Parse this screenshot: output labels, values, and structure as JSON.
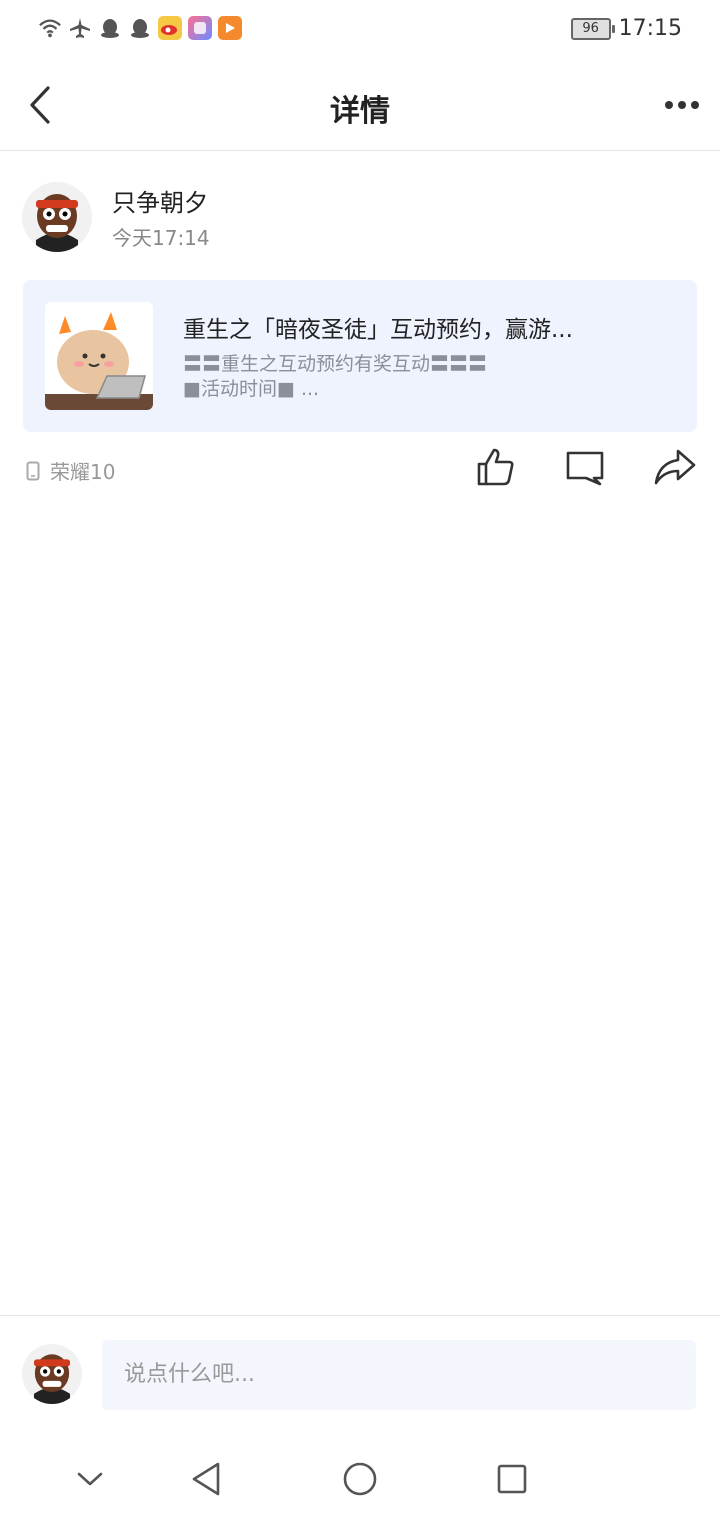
{
  "status_bar": {
    "battery": "96",
    "time": "17:15",
    "icons": [
      "wifi-icon",
      "airplane-icon",
      "qq-icon",
      "qq-icon",
      "weibo-icon",
      "app-icon",
      "video-app-icon"
    ]
  },
  "header": {
    "title": "详情"
  },
  "post": {
    "author_name": "只争朝夕",
    "time": "今天17:14",
    "card": {
      "title": "重生之「暗夜圣徒」互动预约，赢游...",
      "desc_line1": "〓〓重生之互动预约有奖互动〓〓〓",
      "desc_line2": "■活动时间■ ..."
    },
    "device": "荣耀10"
  },
  "comment": {
    "placeholder": "说点什么吧..."
  },
  "colors": {
    "card_bg": "#eef3fe",
    "input_bg": "#f3f6fd",
    "muted_text": "#888888"
  }
}
